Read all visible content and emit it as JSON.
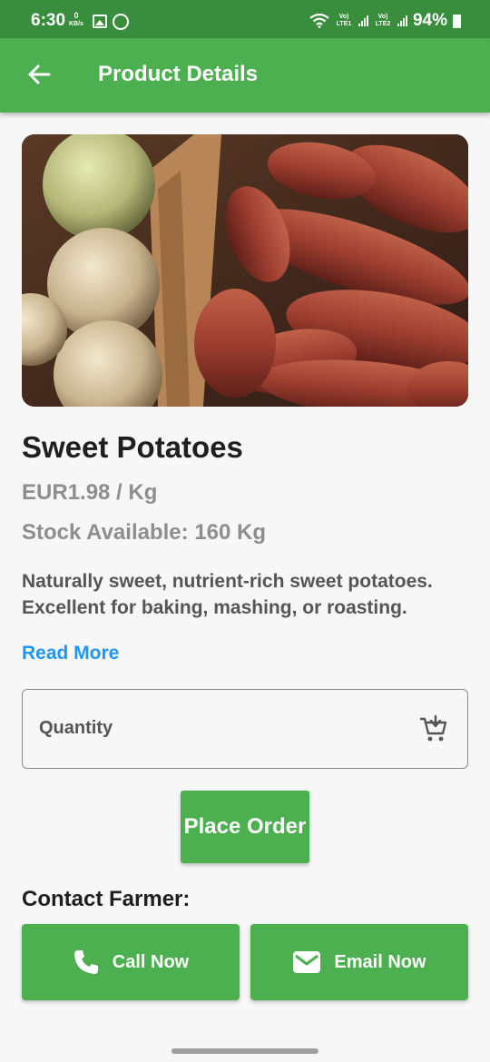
{
  "status_bar": {
    "time": "6:30",
    "net_speed_value": "0",
    "net_speed_unit": "KB/s",
    "sim1_label": "Vo) LTE1",
    "sim2_label": "Vo) LTE2",
    "battery": "94%",
    "icons": [
      "gallery-icon",
      "whatsapp-icon",
      "wifi-icon",
      "signal-icon",
      "battery-icon"
    ]
  },
  "app_bar": {
    "back_icon": "arrow-left-icon",
    "title": "Product Details"
  },
  "product": {
    "name": "Sweet Potatoes",
    "price": "EUR1.98 / Kg",
    "stock": "Stock Available: 160 Kg",
    "description": "Naturally sweet, nutrient-rich sweet potatoes. Excellent for baking, mashing, or roasting.",
    "read_more": "Read More",
    "image_subject": "sweet potatoes and celeriac in a cardboard box"
  },
  "order": {
    "quantity_placeholder": "Quantity",
    "quantity_icon": "add-to-cart-icon",
    "place_order_label": "Place Order"
  },
  "contact": {
    "label": "Contact Farmer:",
    "call_label": "Call Now",
    "call_icon": "phone-icon",
    "email_label": "Email Now",
    "email_icon": "mail-icon"
  },
  "colors": {
    "status_bar": "#388e3c",
    "primary": "#4caf50",
    "link": "#2196f3",
    "muted_text": "#8e8e8e",
    "body_text": "#555555"
  }
}
